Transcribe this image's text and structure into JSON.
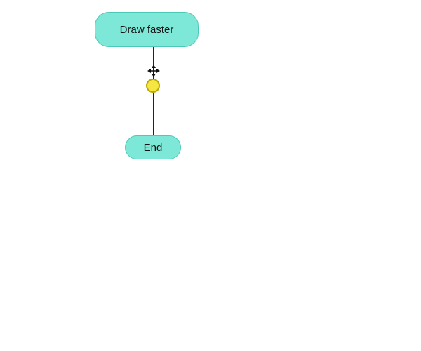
{
  "nodes": {
    "draw_faster": {
      "label": "Draw faster"
    },
    "end": {
      "label": "End"
    }
  },
  "connector": {
    "move_cursor_symbol": "✥"
  }
}
